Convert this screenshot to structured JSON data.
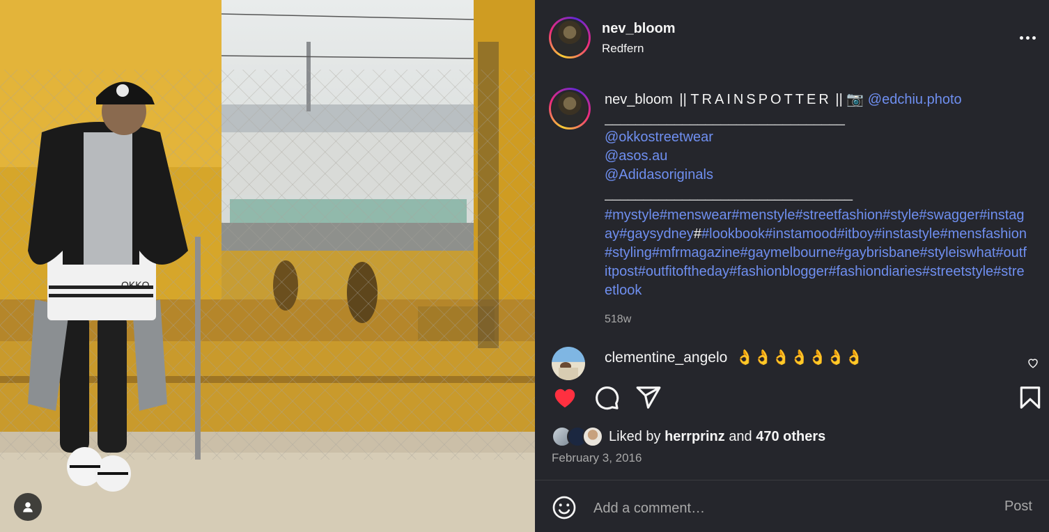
{
  "post": {
    "username": "nev_bloom",
    "location": "Redfern"
  },
  "caption": {
    "username": "nev_bloom",
    "bio_prefix": "||",
    "bio_spaced": "TRAINSPOTTER",
    "bio_suffix": "||",
    "camera_emoji": "📷",
    "photographer": "@edchiu.photo",
    "rule1": "_______________________________",
    "mentions": [
      "@okkostreetwear",
      "@asos.au",
      "@Adidasoriginals"
    ],
    "rule2": "________________________________",
    "hashtags_a": "#mystyle#menswear#menstyle#streetfashion#style#swagger#instagay#gaysydney",
    "hash_plain": "#",
    "hashtags_b": "#lookbook#instamood#itboy#instastyle#mensfashion#styling#mfrmagazine#gaymelbourne#gaybrisbane#styleiswhat#outfitpost#outfitoftheday#fashionblogger#fashiondiaries#streetstyle#streetlook",
    "time_ago": "518w"
  },
  "comment": {
    "username": "clementine_angelo",
    "text": "👌👌👌👌👌👌👌"
  },
  "likes": {
    "prefix": "Liked by",
    "user": "herrprinz",
    "joiner": "and",
    "others": "470 others"
  },
  "date": "February 3, 2016",
  "comment_box": {
    "placeholder": "Add a comment…",
    "post_label": "Post"
  },
  "photo_badge": "OKKO",
  "colors": {
    "background": "#25262c",
    "link": "#6f8ff0",
    "like_red": "#ff3040",
    "muted": "#a8a8a8"
  },
  "icons": [
    "more-icon",
    "heart-icon",
    "comment-icon",
    "share-icon",
    "bookmark-icon",
    "emoji-icon",
    "user-icon",
    "small-heart-icon"
  ]
}
